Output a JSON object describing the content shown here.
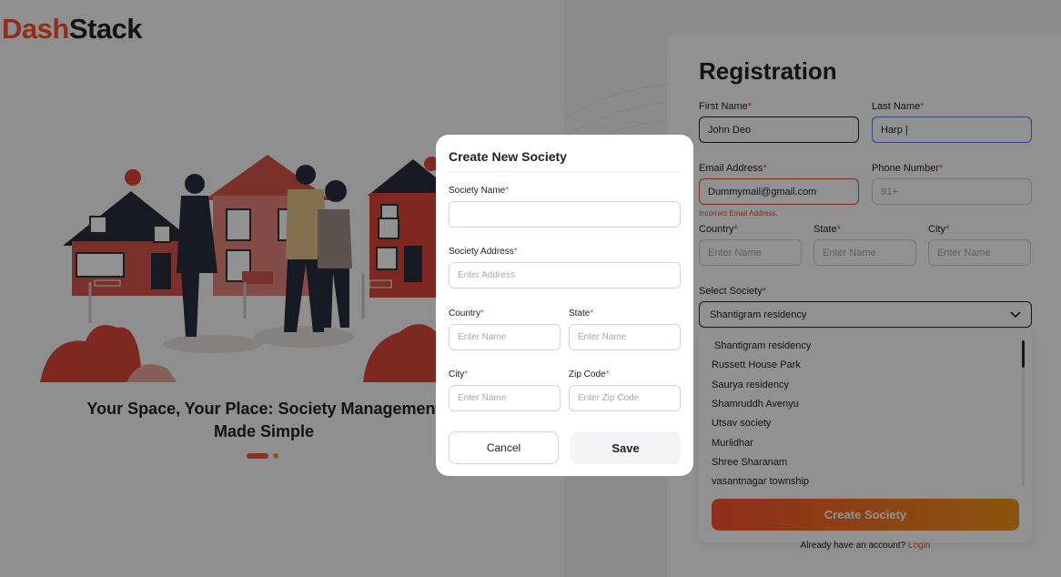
{
  "brand": {
    "logo_part1": "Dash",
    "logo_part2": "Stack"
  },
  "hero": {
    "tagline_line1": "Your Space, Your Place: Society Management",
    "tagline_line2": "Made Simple",
    "slide_count": 2,
    "active_slide": 1
  },
  "registration": {
    "title": "Registration",
    "first_name": {
      "label": "First Name",
      "value": "John Deo"
    },
    "last_name": {
      "label": "Last Name",
      "value": "Harp |"
    },
    "email": {
      "label": "Email Address",
      "value": "Dummymail@gmail.com",
      "error": "Incorrect Email Address."
    },
    "phone": {
      "label": "Phone Number",
      "placeholder": "91+"
    },
    "country": {
      "label": "Country",
      "placeholder": "Enter Name"
    },
    "state": {
      "label": "State",
      "placeholder": "Enter Name"
    },
    "city": {
      "label": "City",
      "placeholder": "Enter Name"
    },
    "select_society": {
      "label": "Select Society",
      "selected": "Shantigram residency",
      "options": [
        "Shantigram residency",
        "Russett House Park",
        "Saurya residency",
        "Shamruddh Avenyu",
        "Utsav society",
        "Murlidhar",
        "Shree Sharanam",
        "vasantnagar township"
      ],
      "create_button": "Create Society"
    },
    "footer_text": "Already have an account?",
    "login_link": "Login"
  },
  "modal": {
    "title": "Create New Society",
    "society_name": {
      "label": "Society Name",
      "placeholder": ""
    },
    "society_address": {
      "label": "Society Address",
      "placeholder": "Enter Address"
    },
    "country": {
      "label": "Country",
      "placeholder": "Enter Name"
    },
    "state": {
      "label": "State",
      "placeholder": "Enter Name"
    },
    "city": {
      "label": "City",
      "placeholder": "Enter Name"
    },
    "zip": {
      "label": "Zip Code",
      "placeholder": "Enter Zip Code"
    },
    "cancel_label": "Cancel",
    "save_label": "Save"
  },
  "colors": {
    "brand": "#fe512e",
    "brand_gradient_end": "#f09619",
    "error": "#e74c3c",
    "focus": "#5678e9"
  }
}
